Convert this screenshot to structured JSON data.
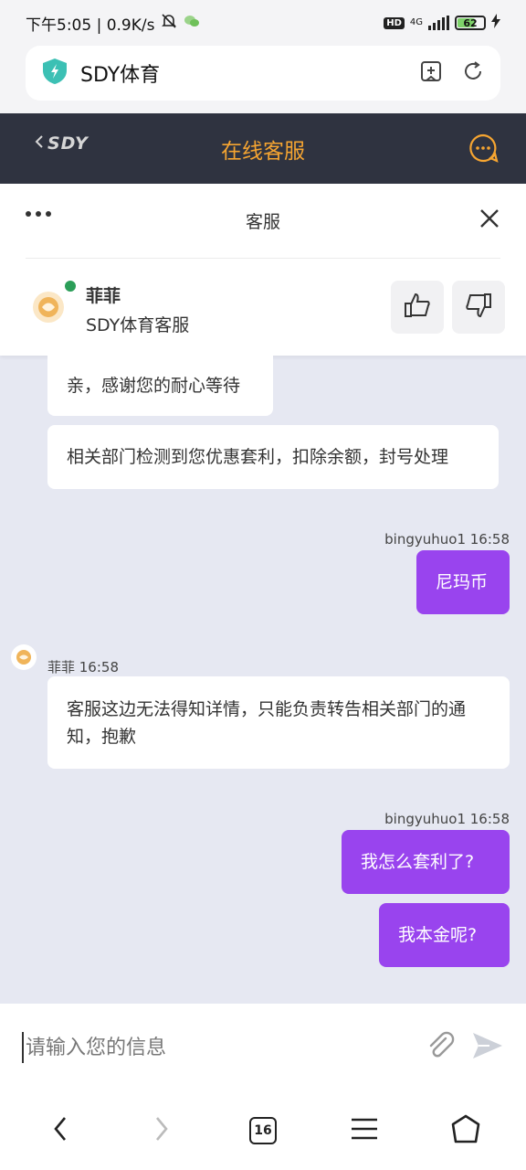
{
  "status_bar": {
    "time_speed": "下午5:05 | 0.9K/s",
    "hd": "HD",
    "network": "4G",
    "battery": "62"
  },
  "browser": {
    "page_title": "SDY体育"
  },
  "header": {
    "back_logo": "SDY",
    "title": "在线客服"
  },
  "panel": {
    "title": "客服",
    "agent_name": "菲菲",
    "agent_role": "SDY体育客服"
  },
  "messages": [
    {
      "sender": "",
      "time": "",
      "text": "亲，感谢您的耐心等待",
      "direction": "in"
    },
    {
      "sender": "",
      "time": "",
      "text": "相关部门检测到您优惠套利，扣除余额，封号处理",
      "direction": "in"
    },
    {
      "sender": "bingyuhuo1 16:58",
      "time": "",
      "text": "尼玛币",
      "direction": "out"
    },
    {
      "sender": "菲菲 16:58",
      "time": "",
      "text": "客服这边无法得知详情，只能负责转告相关部门的通知，抱歉",
      "direction": "in"
    },
    {
      "sender": "bingyuhuo1 16:58",
      "time": "",
      "text": "我怎么套利了?",
      "direction": "out"
    },
    {
      "sender": "",
      "time": "",
      "text": "我本金呢?",
      "direction": "out"
    }
  ],
  "input": {
    "placeholder": "请输入您的信息"
  },
  "nav": {
    "tab_count": "16"
  }
}
